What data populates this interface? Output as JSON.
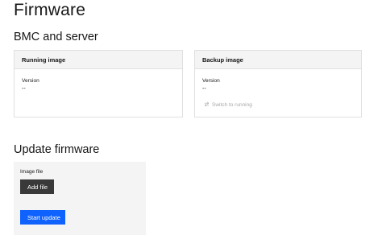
{
  "page": {
    "title": "Firmware"
  },
  "bmc_section": {
    "title": "BMC and server",
    "running_card": {
      "header": "Running image",
      "version_label": "Version",
      "version_value": "--"
    },
    "backup_card": {
      "header": "Backup image",
      "version_label": "Version",
      "version_value": "--",
      "switch_label": "Switch to running",
      "switch_icon": "swap-arrows-icon"
    }
  },
  "update_section": {
    "title": "Update firmware",
    "image_file_label": "Image file",
    "add_file_label": "Add file",
    "start_update_label": "Start update"
  },
  "colors": {
    "primary": "#0f62fe",
    "dark_button": "#393939",
    "panel_bg": "#f4f4f4",
    "disabled_text": "#a8a8a8"
  }
}
